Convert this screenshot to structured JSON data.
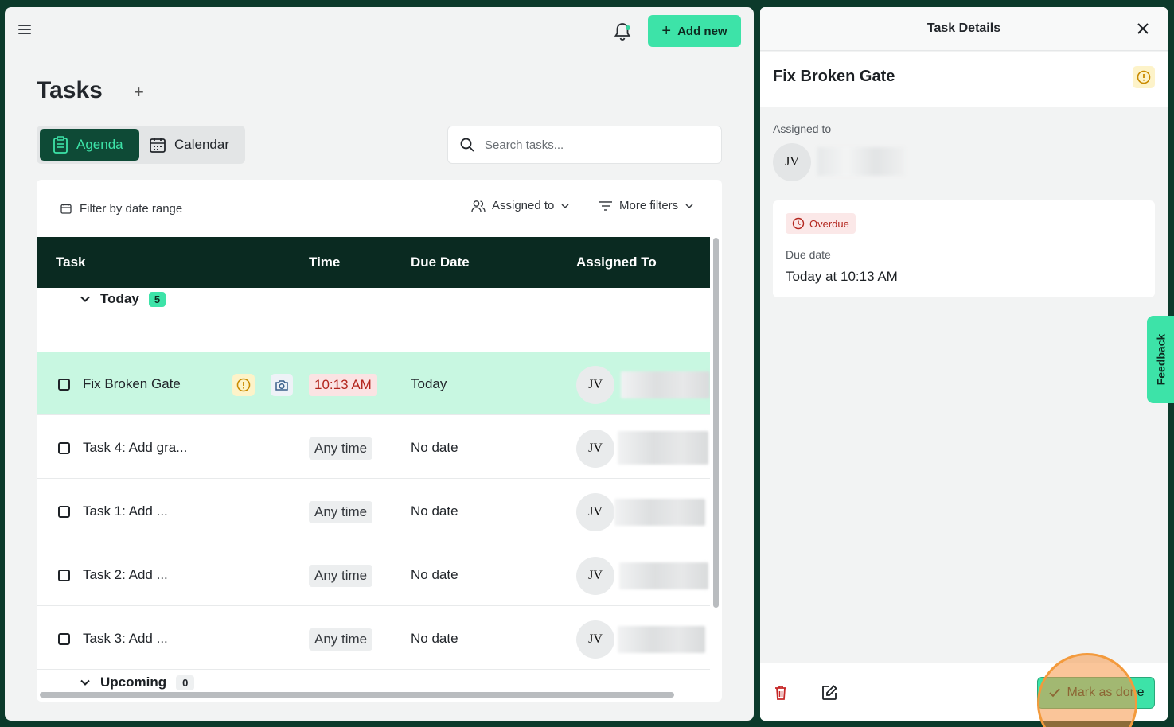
{
  "header": {
    "add_new_label": "Add new"
  },
  "page": {
    "title": "Tasks",
    "title_add": "+"
  },
  "views": {
    "agenda": "Agenda",
    "calendar": "Calendar"
  },
  "search": {
    "placeholder": "Search tasks..."
  },
  "filters": {
    "date_range": "Filter by date range",
    "assigned_to": "Assigned to",
    "more_filters": "More filters"
  },
  "table": {
    "columns": [
      "Task",
      "Time",
      "Due Date",
      "Assigned To"
    ],
    "groups": [
      {
        "label": "Today",
        "count": "5"
      },
      {
        "label": "Upcoming",
        "count": "0"
      }
    ],
    "rows": [
      {
        "name": "Fix Broken Gate",
        "time": "10:13 AM",
        "due": "Today",
        "avatar": "JV"
      },
      {
        "name": "Task 4: Add gra...",
        "time": "Any time",
        "due": "No date",
        "avatar": "JV"
      },
      {
        "name": "Task 1: Add ...",
        "time": "Any time",
        "due": "No date",
        "avatar": "JV"
      },
      {
        "name": "Task 2: Add ...",
        "time": "Any time",
        "due": "No date",
        "avatar": "JV"
      },
      {
        "name": "Task 3: Add ...",
        "time": "Any time",
        "due": "No date",
        "avatar": "JV"
      }
    ]
  },
  "details": {
    "header_title": "Task Details",
    "task_title": "Fix Broken Gate",
    "assigned_label": "Assigned to",
    "avatar": "JV",
    "status_badge": "Overdue",
    "due_label": "Due date",
    "due_value": "Today at 10:13 AM",
    "mark_done_label": "Mark as done"
  },
  "feedback": {
    "label": "Feedback"
  },
  "colors": {
    "brand_dark": "#0e4a36",
    "accent": "#3de3a8",
    "overdue": "#b3261e",
    "warning_bg": "#fdf3c9"
  }
}
